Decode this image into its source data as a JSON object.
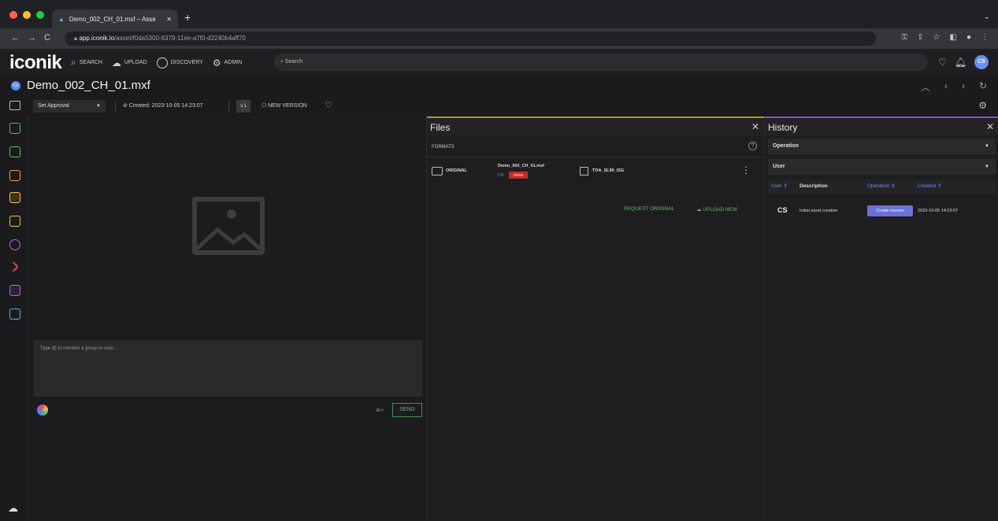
{
  "browser": {
    "tab_title": "Demo_002_CH_01.mxf – Asse",
    "url_domain": "app.iconik.io",
    "url_path": "/asset/f0da5300-6379-11ee-a7f0-d2240b4aff70"
  },
  "topbar": {
    "logo": "iconik",
    "nav": [
      {
        "label": "SEARCH",
        "icon": "search-icon"
      },
      {
        "label": "UPLOAD",
        "icon": "upload-cloud-icon"
      },
      {
        "label": "DISCOVERY",
        "icon": "compass-icon"
      },
      {
        "label": "ADMIN",
        "icon": "gear-icon"
      }
    ],
    "search_placeholder": "Search",
    "avatar": "CS"
  },
  "asset": {
    "title": "Demo_002_CH_01.mxf",
    "avatar": "CS",
    "approval": "Set Approval",
    "created": "Created: 2023-10-05 14:23:07",
    "version": "v.1",
    "new_version": "NEW VERSION"
  },
  "comments": {
    "placeholder": "Type @ to mention a group or user...",
    "shortcut": "⌘↵",
    "send": "SEND"
  },
  "files": {
    "title": "Files",
    "formats_label": "FORMATS",
    "format_name": "ORIGINAL",
    "file_name": "Demo_002_CH_01.mxf",
    "file_size": "0 B",
    "badge": "OPEN",
    "storage": "TOA_SL90_ISG",
    "request_original": "REQUEST ORIGINAL",
    "upload_new": "UPLOAD NEW"
  },
  "history": {
    "title": "History",
    "filter_operation": "Operation",
    "filter_user": "User",
    "columns": [
      "User",
      "Description",
      "Operation",
      "Created"
    ],
    "rows": [
      {
        "user": "CS",
        "description": "Initial asset creation",
        "operation": "Create version",
        "created": "2023-10-05 14:23:07"
      }
    ]
  },
  "colors": {
    "files_accent": "#b8932f",
    "history_accent": "#8e4fc7",
    "send_green": "#6fb56f",
    "open_badge": "#c92828",
    "operation_badge": "#6a72d6"
  }
}
